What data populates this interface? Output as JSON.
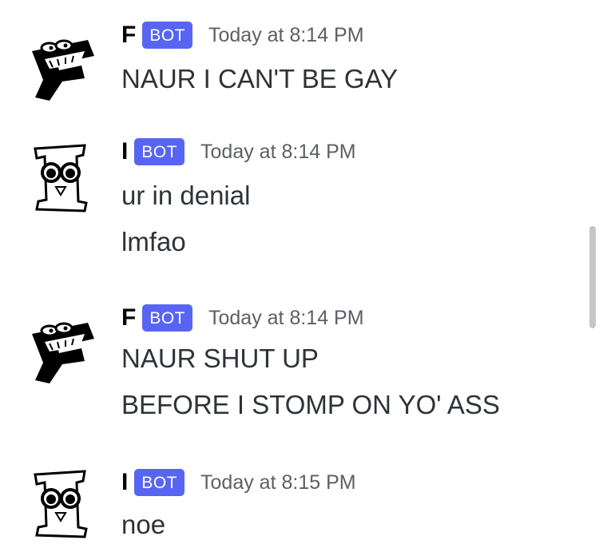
{
  "messages": [
    {
      "author": "F",
      "tag": "BOT",
      "timestamp": "Today at 8:14 PM",
      "avatar_icon": "f-character-avatar-icon",
      "lines": [
        "NAUR I CAN'T BE GAY"
      ]
    },
    {
      "author": "I",
      "tag": "BOT",
      "timestamp": "Today at 8:14 PM",
      "avatar_icon": "i-character-avatar-icon",
      "lines": [
        "ur in denial",
        "lmfao"
      ]
    },
    {
      "author": "F",
      "tag": "BOT",
      "timestamp": "Today at 8:14 PM",
      "avatar_icon": "f-character-avatar-icon",
      "lines": [
        "NAUR SHUT UP",
        "BEFORE I STOMP ON YO' ASS"
      ]
    },
    {
      "author": "I",
      "tag": "BOT",
      "timestamp": "Today at 8:15 PM",
      "avatar_icon": "i-character-avatar-icon",
      "lines": [
        "noe"
      ]
    }
  ],
  "colors": {
    "bot_tag": "#5865f2",
    "author": "#060607",
    "message_text": "#2e3338",
    "timestamp": "#5c5f66",
    "background": "#ffffff"
  }
}
